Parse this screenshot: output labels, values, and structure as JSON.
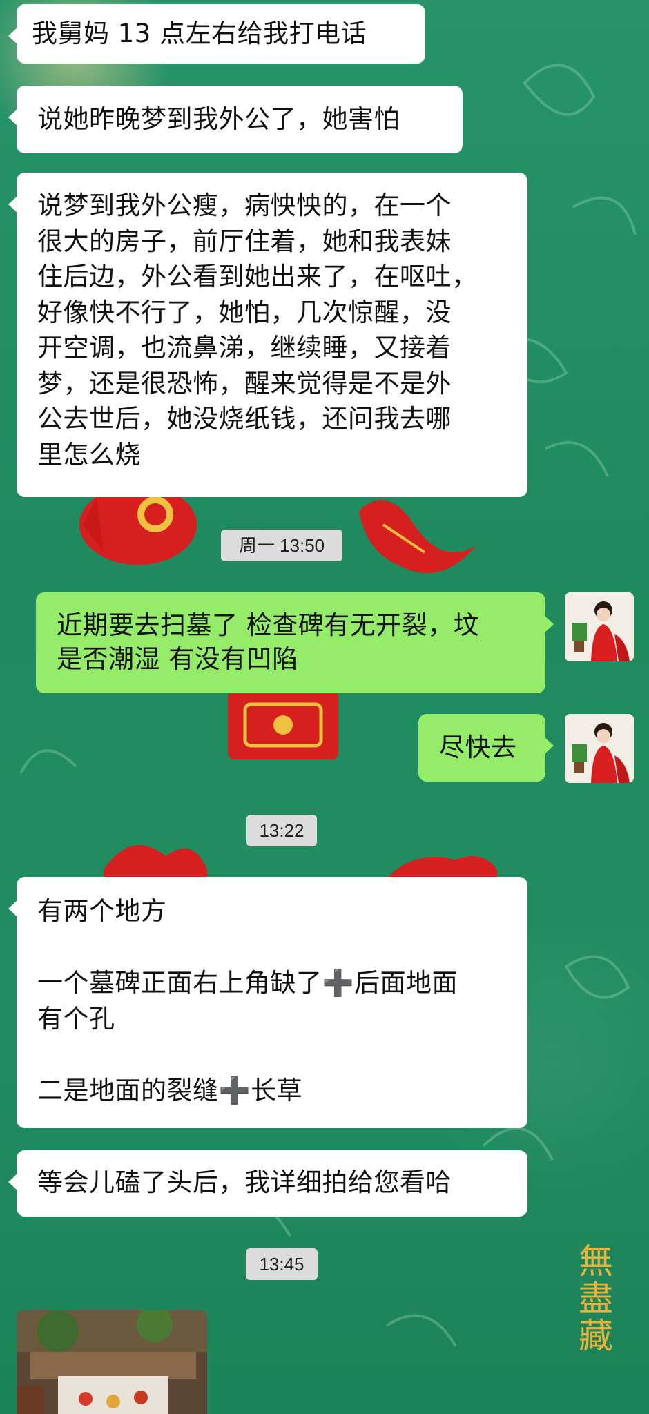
{
  "messages": [
    {
      "id": "m1",
      "side": "in",
      "text": "我舅妈 13 点左右给我打电话"
    },
    {
      "id": "m2",
      "side": "in",
      "text": "说她昨晚梦到我外公了，她害怕"
    },
    {
      "id": "m3",
      "side": "in",
      "lines": [
        "说梦到我外公瘦，病怏怏的，在一个",
        "很大的房子，前厅住着，她和我表妹",
        "住后边，外公看到她出来了，在呕吐，",
        "好像快不行了，她怕，几次惊醒，没",
        "开空调，也流鼻涕，继续睡，又接着",
        "梦，还是很恐怖，醒来觉得是不是外",
        "公去世后，她没烧纸钱，还问我去哪",
        "里怎么烧"
      ]
    },
    {
      "id": "t1",
      "type": "time",
      "text": "周一 13:50"
    },
    {
      "id": "m4",
      "side": "out",
      "lines": [
        "近期要去扫墓了 检查碑有无开裂，坟",
        "是否潮湿 有没有凹陷"
      ]
    },
    {
      "id": "m5",
      "side": "out",
      "text": "尽快去"
    },
    {
      "id": "t2",
      "type": "time",
      "text": "13:22"
    },
    {
      "id": "m6",
      "side": "in",
      "lines": [
        "有两个地方",
        "",
        "一个墓碑正面右上角缺了➕后面地面",
        "有个孔",
        "",
        "二是地面的裂缝➕长草"
      ]
    },
    {
      "id": "m7",
      "side": "in",
      "text": "等会儿磕了头后，我详细拍给您看哈"
    },
    {
      "id": "t3",
      "type": "time",
      "text": "13:45"
    }
  ],
  "background_calligraphy": "無盡藏",
  "icons": {
    "avatar": "avatar-portrait-icon",
    "photo": "photo-thumbnail"
  },
  "colors": {
    "incoming": "#ffffff",
    "outgoing": "#95ec69",
    "timestamp_bg": "#dcdcdc",
    "background": "#1f8a5c"
  }
}
